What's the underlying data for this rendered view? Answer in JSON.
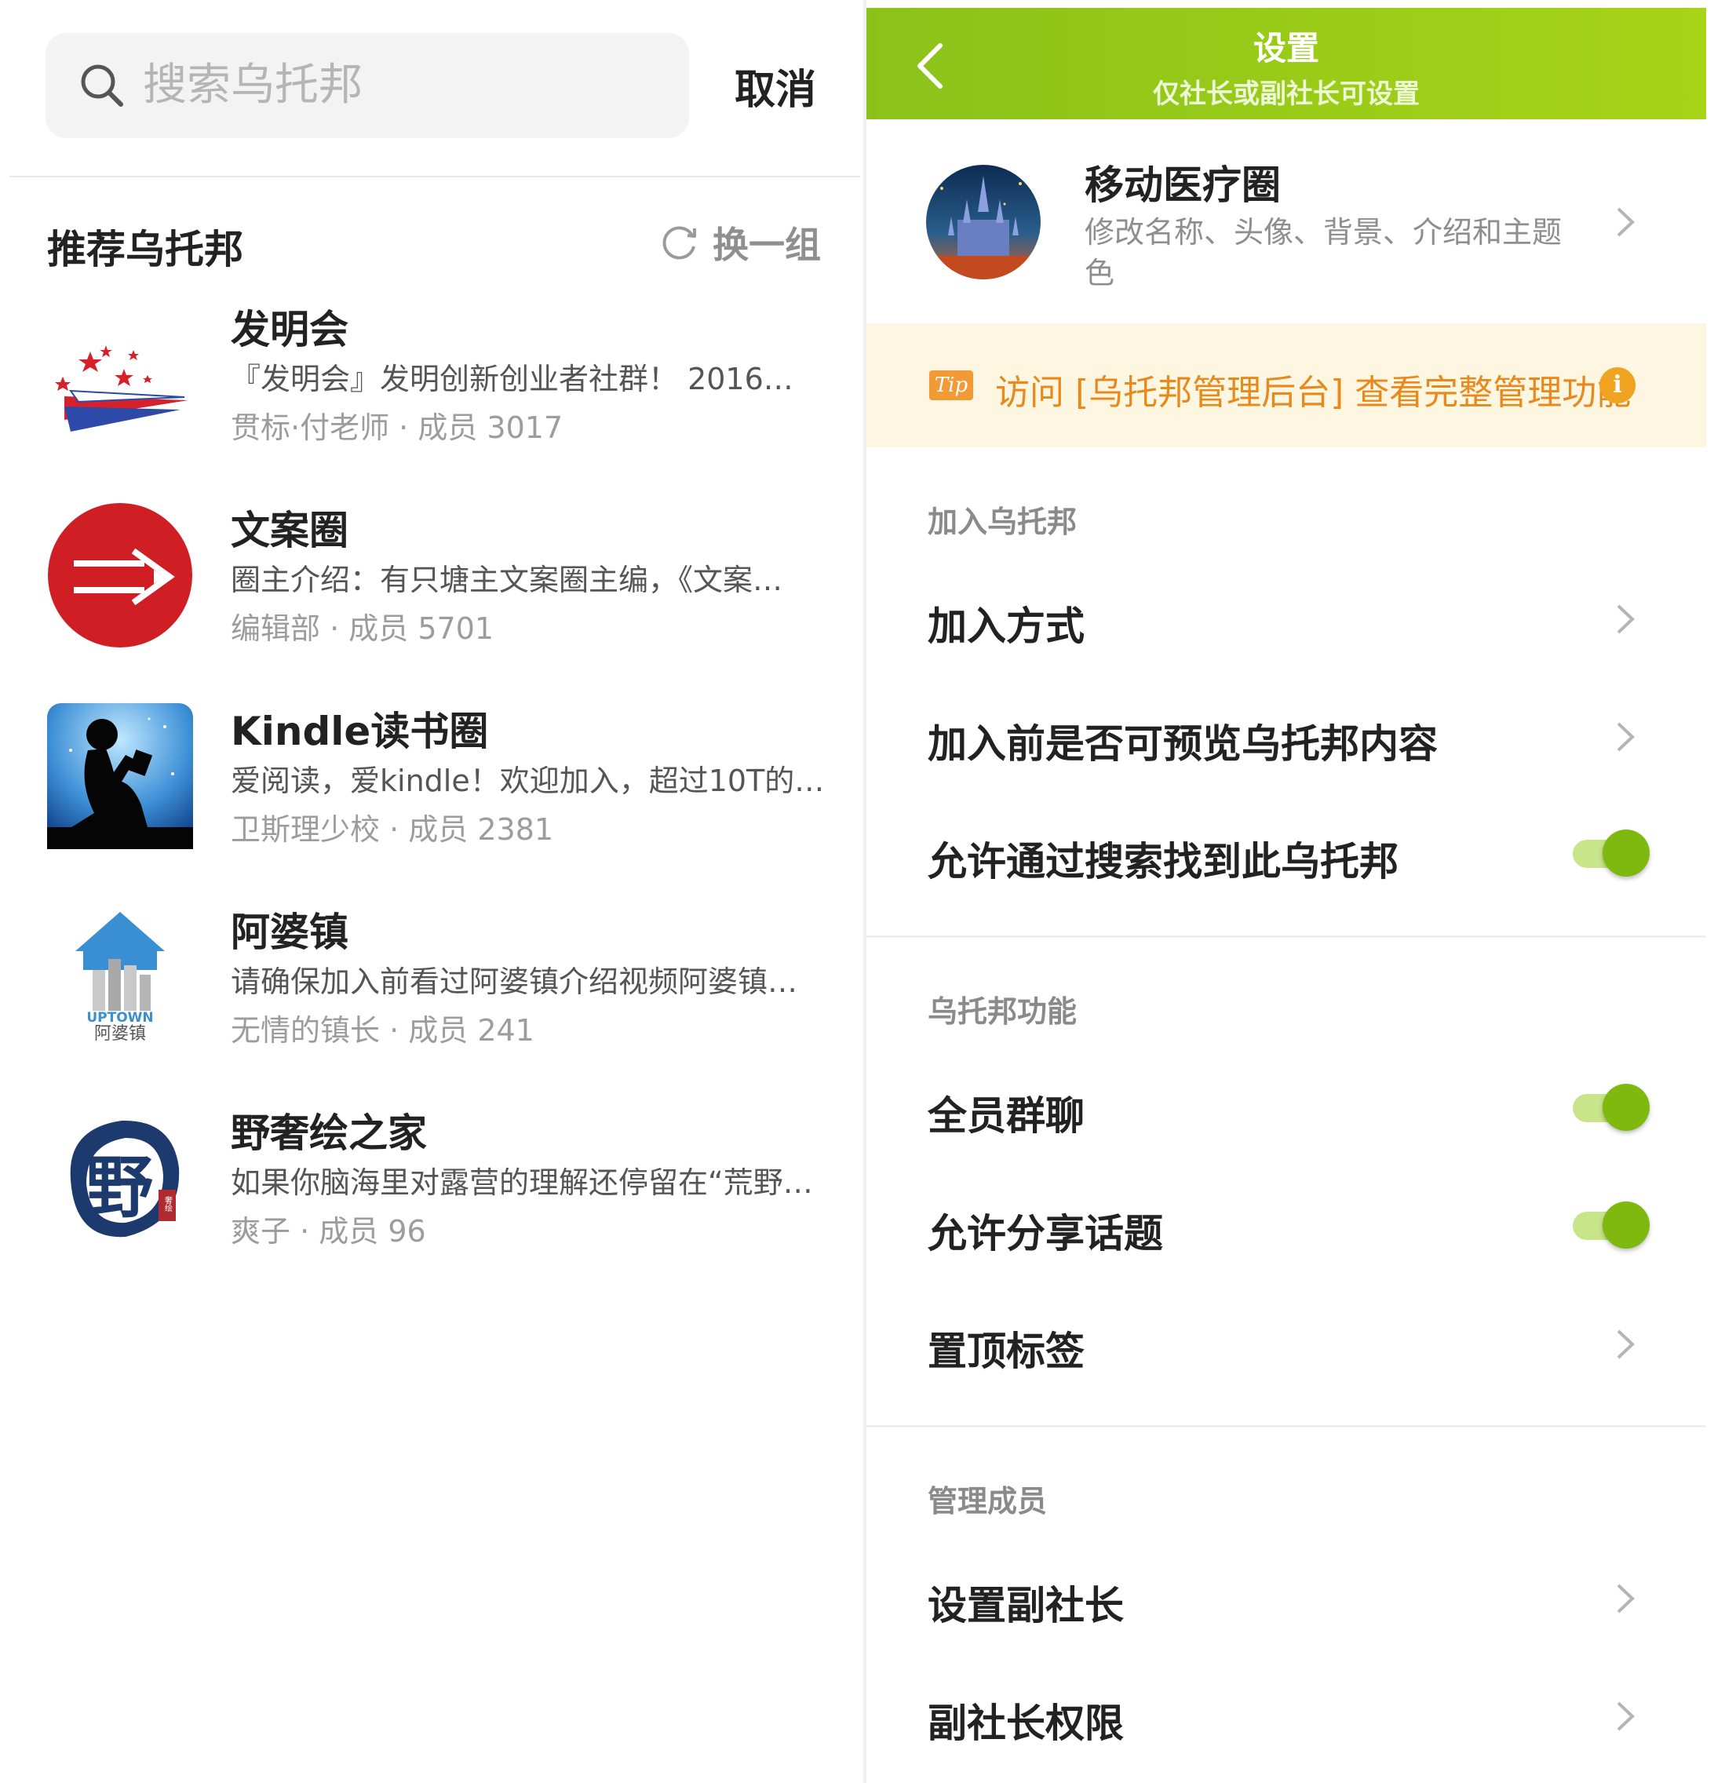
{
  "search": {
    "placeholder": "搜索乌托邦",
    "cancel_label": "取消"
  },
  "recommend": {
    "title": "推荐乌托邦",
    "refresh_label": "换一组",
    "groups": [
      {
        "name": "发明会",
        "desc": "『发明会』发明创新创业者社群！ 2016…",
        "owner": "贯标·付老师",
        "members": "成员 3017",
        "logo": "invention-logo"
      },
      {
        "name": "文案圈",
        "desc": "圈主介绍：有只塘主文案圈主编，《文案…",
        "owner": "编辑部",
        "members": "成员 5701",
        "logo": "pencil-logo"
      },
      {
        "name": "Kindle读书圈",
        "desc": "爱阅读，爱kindle！欢迎加入，超过10T的…",
        "owner": "卫斯理少校",
        "members": "成员 2381",
        "logo": "kindle-logo"
      },
      {
        "name": "阿婆镇",
        "desc": "请确保加入前看过阿婆镇介绍视频阿婆镇…",
        "owner": "无情的镇长",
        "members": "成员 241",
        "logo": "uptown-logo"
      },
      {
        "name": "野奢绘之家",
        "desc": "如果你脑海里对露营的理解还停留在“荒野…",
        "owner": "爽子",
        "members": "成员 96",
        "logo": "ye-logo"
      }
    ],
    "meta_separator": " · "
  },
  "logos": {
    "uptown_text": "UPTOWN",
    "uptown_cn": "阿婆镇",
    "ye_char": "野",
    "ye_seal": "奢绘"
  },
  "settings": {
    "title": "设置",
    "subtitle": "仅社长或副社长可设置",
    "profile": {
      "name": "移动医疗圈",
      "desc": "修改名称、头像、背景、介绍和主题色"
    },
    "tip": {
      "badge": "Tip",
      "text": "访问 [乌托邦管理后台] 查看完整管理功能",
      "info": "i"
    },
    "section_join": "加入乌托邦",
    "join_method": "加入方式",
    "preview_before_join": "加入前是否可预览乌托邦内容",
    "searchable": {
      "label": "允许通过搜索找到此乌托邦",
      "on": true
    },
    "section_features": "乌托邦功能",
    "group_chat": {
      "label": "全员群聊",
      "on": true
    },
    "share_topics": {
      "label": "允许分享话题",
      "on": true
    },
    "pinned_tags": "置顶标签",
    "section_members": "管理成员",
    "set_vice": "设置副社长",
    "vice_permissions": "副社长权限"
  },
  "colors": {
    "header_green": "#8bc21a",
    "toggle_on": "#7fb80e",
    "tip_orange": "#e8891e",
    "tip_bg": "#fdf6e0"
  }
}
